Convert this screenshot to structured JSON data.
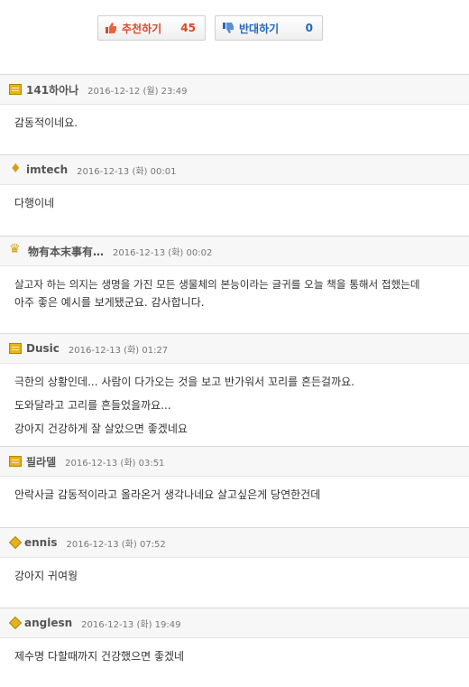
{
  "vote": {
    "recommend_label": "추천하기",
    "recommend_count": "45",
    "oppose_label": "반대하기",
    "oppose_count": "0"
  },
  "comments": [
    {
      "badge": "bar",
      "nick": "141하아나",
      "date": "2016-12-12 (월) 23:49",
      "lines": [
        "감동적이네요."
      ]
    },
    {
      "badge": "wings",
      "nick": "imtech",
      "date": "2016-12-13 (화) 00:01",
      "lines": [
        "다행이네"
      ]
    },
    {
      "badge": "crown",
      "nick": "物有本末事有…",
      "date": "2016-12-13 (화) 00:02",
      "lines": [
        "살고자 하는 의지는 생명을 가진 모든 생물체의 본능이라는 글귀를 오늘 책을 통해서 접했는데",
        "아주 좋은 예시를 보게됐군요. 감사합니다."
      ]
    },
    {
      "badge": "bar",
      "nick": "Dusic",
      "date": "2016-12-13 (화) 01:27",
      "lines": [
        "극한의 상황인데... 사람이 다가오는 것을 보고 반가워서 꼬리를 흔든걸까요.",
        "도와달라고 고리를 흔들었을까요...",
        "강아지 건강하게 잘 살았으면 좋겠네요"
      ]
    },
    {
      "badge": "bar",
      "nick": "필라델",
      "date": "2016-12-13 (화) 03:51",
      "lines": [
        "안락사글 감동적이라고 올라온거 생각나네요 살고싶은게 당연한건데"
      ]
    },
    {
      "badge": "diamond",
      "nick": "ennis",
      "date": "2016-12-13 (화) 07:52",
      "lines": [
        "강아지 귀여웡"
      ]
    },
    {
      "badge": "diamond",
      "nick": "anglesn",
      "date": "2016-12-13 (화) 19:49",
      "lines": [
        "제수명 다할때까지 건강했으면 좋겠네"
      ]
    }
  ]
}
